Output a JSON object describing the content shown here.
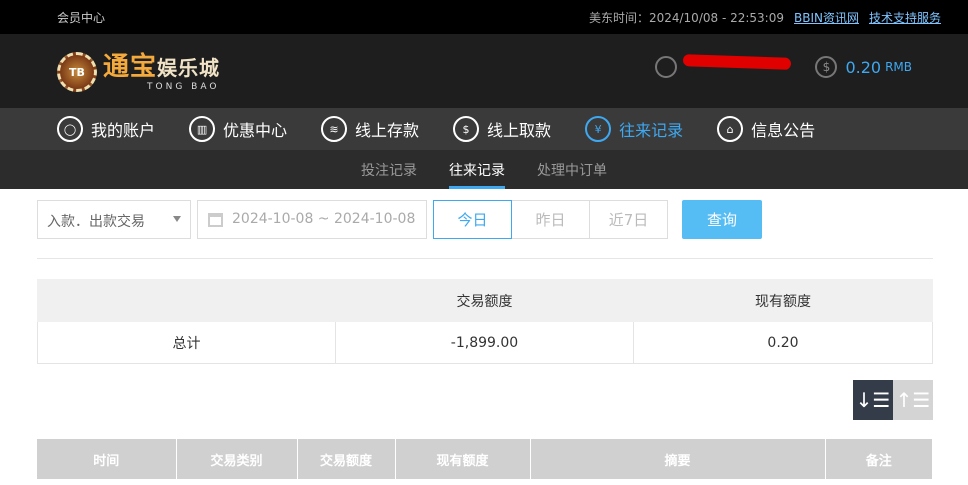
{
  "topbar": {
    "member_center": "会员中心",
    "time": "美东时间：2024/10/08 - 22:53:09",
    "link_bbin": "BBIN资讯网",
    "link_support": "技术支持服务"
  },
  "brand": {
    "badge": "TB",
    "name_main": "通宝",
    "name_tail": "娱乐城",
    "sub": "TONG BAO"
  },
  "account": {
    "balance": "0.20",
    "currency": "RMB"
  },
  "nav": [
    {
      "label": "我的账户",
      "icon": "user-icon"
    },
    {
      "label": "优惠中心",
      "icon": "gift-icon"
    },
    {
      "label": "线上存款",
      "icon": "deposit-icon"
    },
    {
      "label": "线上取款",
      "icon": "withdraw-icon"
    },
    {
      "label": "往来记录",
      "icon": "record-icon",
      "active": true
    },
    {
      "label": "信息公告",
      "icon": "bell-icon"
    }
  ],
  "subnav": [
    {
      "label": "投注记录"
    },
    {
      "label": "往来记录",
      "active": true
    },
    {
      "label": "处理中订单"
    }
  ],
  "filters": {
    "type_select": "入款．出款交易",
    "date_range": "2024-10-08 ~ 2024-10-08",
    "today": "今日",
    "yesterday": "昨日",
    "last7": "近7日",
    "query": "查询"
  },
  "summary": {
    "headers": [
      "",
      "交易额度",
      "现有额度"
    ],
    "row": [
      "总计",
      "-1,899.00",
      "0.20"
    ]
  },
  "records": {
    "headers": [
      "时间",
      "交易类别",
      "交易额度",
      "现有额度",
      "摘要",
      "备注"
    ]
  },
  "colors": {
    "accent": "#3ea8f0",
    "query_button": "#56bdf4",
    "topbar": "#000000",
    "header": "#1e1e1e",
    "nav": "#3a3a3a"
  }
}
